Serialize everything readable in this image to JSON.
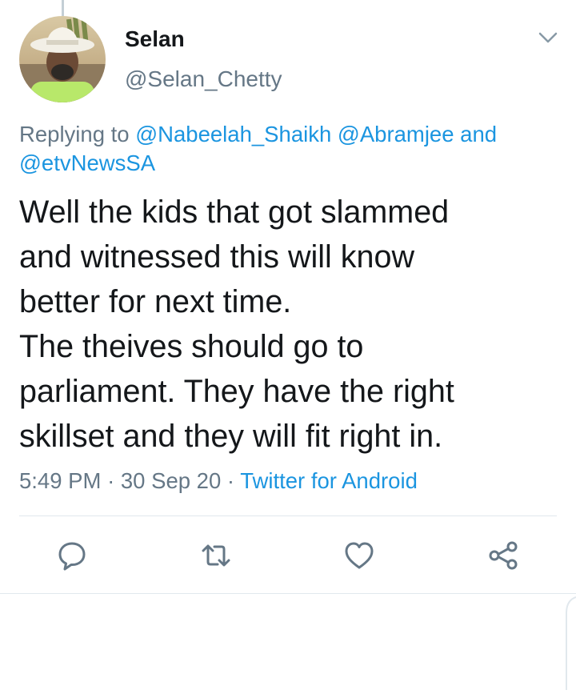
{
  "tweet": {
    "display_name": "Selan",
    "handle": "@Selan_Chetty",
    "replying_prefix": "Replying to",
    "mentions": [
      "@Nabeelah_Shaikh",
      "@Abramjee"
    ],
    "mentions_conjunction": "and",
    "last_mention": "@etvNewsSA",
    "text": "Well the kids that got slammed\nand witnessed this will know\nbetter for next time.\nThe theives should go to\nparliament. They have the right\nskillset and they will fit right in.",
    "time": "5:49 PM",
    "separator": "·",
    "date": "30 Sep 20",
    "source": "Twitter for Android"
  },
  "actions": {
    "reply_icon": "speech-bubble-icon",
    "retweet_icon": "retweet-arrows-icon",
    "like_icon": "heart-icon",
    "share_icon": "share-nodes-icon"
  },
  "colors": {
    "text_primary": "#14171a",
    "text_secondary": "#657786",
    "link": "#1b95e0",
    "divider": "#e1e8ed",
    "icon": "#657786"
  }
}
